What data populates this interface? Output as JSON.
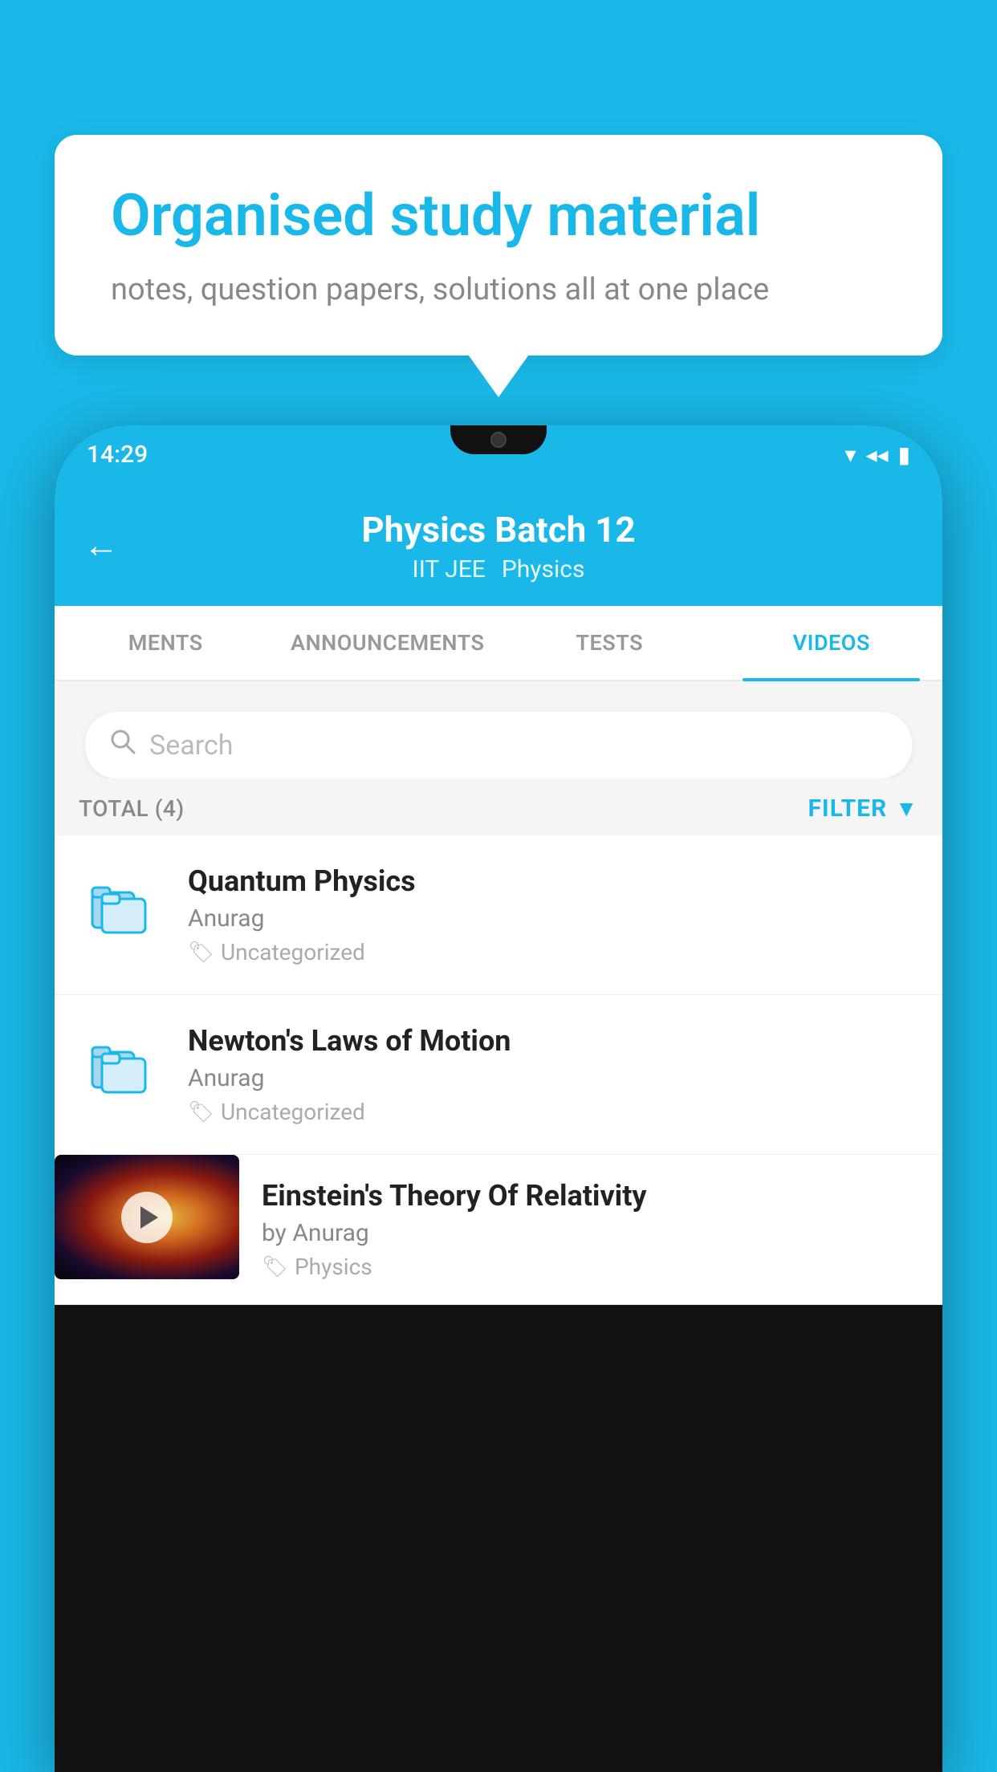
{
  "page": {
    "background_color": "#1ab8e8"
  },
  "bubble": {
    "title": "Organised study material",
    "subtitle": "notes, question papers, solutions all at one place"
  },
  "status_bar": {
    "time": "14:29",
    "wifi_icon": "▼",
    "signal_icon": "◂",
    "battery_icon": "▮"
  },
  "header": {
    "back_icon": "←",
    "title": "Physics Batch 12",
    "tags": [
      "IIT JEE",
      "Physics"
    ]
  },
  "tabs": [
    {
      "label": "MENTS",
      "active": false
    },
    {
      "label": "ANNOUNCEMENTS",
      "active": false
    },
    {
      "label": "TESTS",
      "active": false
    },
    {
      "label": "VIDEOS",
      "active": true
    }
  ],
  "search": {
    "placeholder": "Search",
    "search_icon": "🔍"
  },
  "filter_row": {
    "total_label": "TOTAL (4)",
    "filter_label": "FILTER",
    "filter_icon": "▼"
  },
  "videos": [
    {
      "title": "Quantum Physics",
      "author": "Anurag",
      "tag": "Uncategorized",
      "has_video_thumb": false
    },
    {
      "title": "Newton's Laws of Motion",
      "author": "Anurag",
      "tag": "Uncategorized",
      "has_video_thumb": false
    },
    {
      "title": "Einstein's Theory Of Relativity",
      "author": "by Anurag",
      "tag": "Physics",
      "has_video_thumb": true
    }
  ]
}
